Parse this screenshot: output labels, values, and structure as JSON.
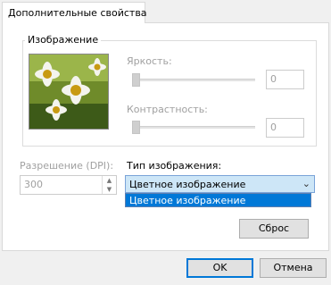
{
  "tab": {
    "label": "Дополнительные свойства"
  },
  "image_group": {
    "title": "Изображение",
    "brightness": {
      "label": "Яркость:",
      "value": "0",
      "level": 0
    },
    "contrast": {
      "label": "Контрастность:",
      "value": "0",
      "level": 0
    }
  },
  "resolution": {
    "label": "Разрешение (DPI):",
    "value": "300"
  },
  "image_type": {
    "label": "Тип изображения:",
    "selected": "Цветное изображение",
    "options": [
      "Цветное изображение"
    ]
  },
  "buttons": {
    "reset": "Сброс",
    "ok": "OK",
    "cancel": "Отмена"
  },
  "colors": {
    "accent": "#0078d7",
    "combo_bg": "#cde6f7"
  }
}
